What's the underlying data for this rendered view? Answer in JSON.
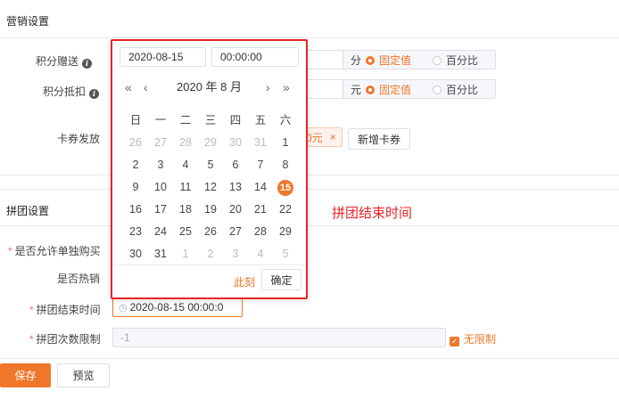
{
  "marketing": {
    "section_title": "营销设置",
    "points_gift_label": "积分赠送",
    "points_gift_unit": "分",
    "points_deduct_label": "积分抵扣",
    "points_deduct_unit": "元",
    "fixed_label": "固定值",
    "percent_label": "百分比",
    "coupon_label": "卡券发放",
    "coupon_tag": "0元",
    "coupon_tag_close": "×",
    "add_coupon_button": "新增卡券"
  },
  "group": {
    "section_title": "拼团设置",
    "allow_single_label": "是否允许单独购买",
    "is_hot_label": "是否热销",
    "end_time_label": "拼团结束时间",
    "end_time_value": "2020-08-15 00:00:0",
    "limit_label": "拼团次数限制",
    "limit_value": "-1",
    "unlimited_label": "无限制"
  },
  "annotation": "拼团结束时间",
  "calendar": {
    "date_input": "2020-08-15",
    "time_input": "00:00:00",
    "title": "2020 年  8 月",
    "prev_year": "«",
    "prev_month": "‹",
    "next_month": "›",
    "next_year": "»",
    "weekdays": [
      "日",
      "一",
      "二",
      "三",
      "四",
      "五",
      "六"
    ],
    "weeks": [
      [
        "26",
        "27",
        "28",
        "29",
        "30",
        "31",
        "1"
      ],
      [
        "2",
        "3",
        "4",
        "5",
        "6",
        "7",
        "8"
      ],
      [
        "9",
        "10",
        "11",
        "12",
        "13",
        "14",
        "15"
      ],
      [
        "16",
        "17",
        "18",
        "19",
        "20",
        "21",
        "22"
      ],
      [
        "23",
        "24",
        "25",
        "26",
        "27",
        "28",
        "29"
      ],
      [
        "30",
        "31",
        "1",
        "2",
        "3",
        "4",
        "5"
      ]
    ],
    "now_button": "此刻",
    "confirm_button": "确定"
  },
  "footer": {
    "save_button": "保存",
    "preview_button": "预览"
  },
  "colors": {
    "accent": "#f0762a",
    "annotation_red": "#e82323"
  }
}
